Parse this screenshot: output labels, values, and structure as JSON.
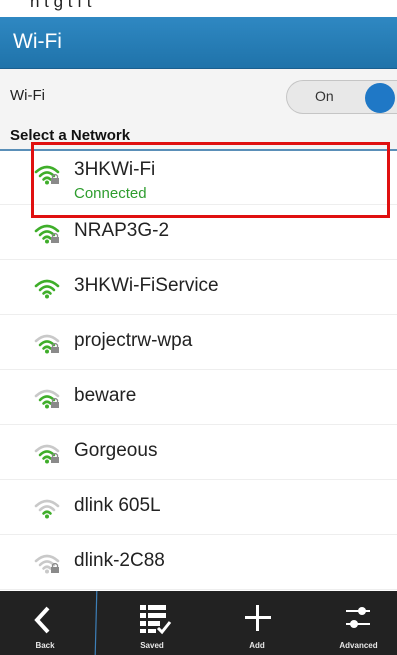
{
  "top_strip": {
    "text": "n   t   g   t      f   t   "
  },
  "header": {
    "title": "Wi-Fi"
  },
  "wifi_toggle": {
    "label": "Wi-Fi",
    "state_label": "On",
    "enabled": true,
    "accent": "#1f78c6"
  },
  "section": {
    "label": "Select a Network"
  },
  "networks": [
    {
      "name": "3HKWi-Fi",
      "status": "Connected",
      "locked": true,
      "signal": 3,
      "highlighted": true
    },
    {
      "name": "NRAP3G-2",
      "locked": true,
      "signal": 3
    },
    {
      "name": "3HKWi-FiService",
      "locked": false,
      "signal": 3
    },
    {
      "name": "projectrw-wpa",
      "locked": true,
      "signal": 2
    },
    {
      "name": "beware",
      "locked": true,
      "signal": 2
    },
    {
      "name": "Gorgeous",
      "locked": true,
      "signal": 2
    },
    {
      "name": "dlink 605L",
      "locked": false,
      "signal": 1
    },
    {
      "name": "dlink-2C88",
      "locked": true,
      "signal": 0
    }
  ],
  "colors": {
    "signal_on": "#3fae2a",
    "signal_off": "#c9c9c9",
    "connected": "#2e9d2e",
    "highlight": "#e01010"
  },
  "bottom_bar": {
    "back": {
      "label": "Back",
      "icon": "back-chevron-icon"
    },
    "saved": {
      "label": "Saved",
      "icon": "saved-list-icon"
    },
    "add": {
      "label": "Add",
      "icon": "plus-icon"
    },
    "advanced": {
      "label": "Advanced",
      "icon": "sliders-icon"
    }
  }
}
